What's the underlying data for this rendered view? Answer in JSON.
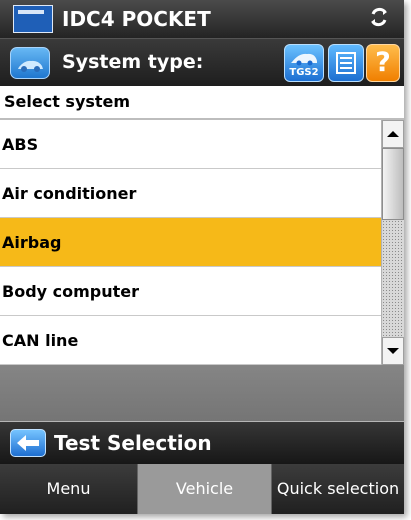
{
  "app": {
    "title": "IDC4 POCKET"
  },
  "header": {
    "title": "System type:",
    "tgs_label": "TGS2"
  },
  "select_label": "Select system",
  "list": {
    "items": [
      {
        "label": "ABS"
      },
      {
        "label": "Air conditioner"
      },
      {
        "label": "Airbag"
      },
      {
        "label": "Body computer"
      },
      {
        "label": "CAN line"
      }
    ],
    "selected_index": 2
  },
  "footer": {
    "back_label": "Test Selection"
  },
  "tabs": [
    {
      "label": "Menu"
    },
    {
      "label": "Vehicle"
    },
    {
      "label": "Quick selection"
    }
  ],
  "icons": {
    "app_logo": "app-logo-icon",
    "sync": "sync-icon",
    "car": "car-icon",
    "tgs": "tgs-icon",
    "list": "list-icon",
    "help": "help-icon",
    "back": "arrow-left-icon",
    "scroll_up": "scroll-up-icon",
    "scroll_down": "scroll-down-icon"
  },
  "colors": {
    "selected": "#f6b918",
    "accent_blue": "#1f77cf",
    "help_orange": "#f07f00"
  }
}
